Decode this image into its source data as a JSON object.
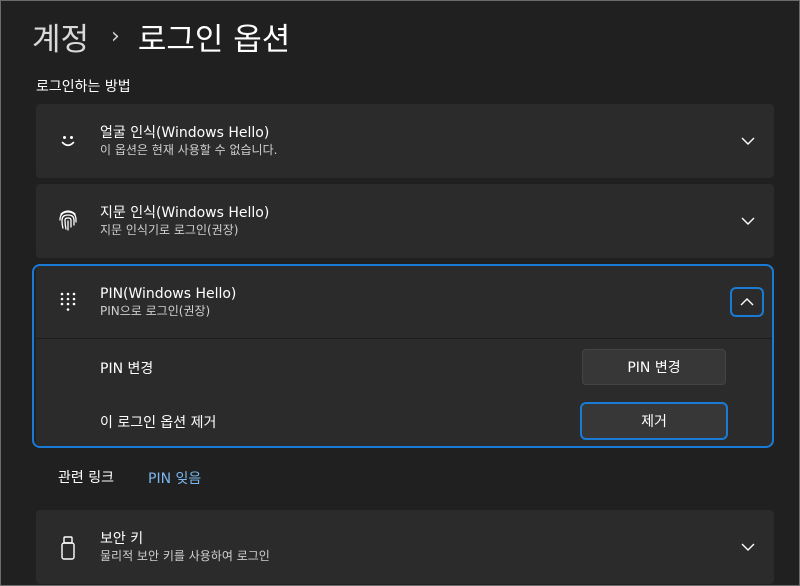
{
  "breadcrumb": {
    "parent": "계정",
    "separator": "›",
    "current": "로그인 옵션"
  },
  "section_title": "로그인하는 방법",
  "options": {
    "face": {
      "title": "얼굴 인식(Windows Hello)",
      "subtitle": "이 옵션은 현재 사용할 수 없습니다.",
      "icon": "smiley-face-icon"
    },
    "fingerprint": {
      "title": "지문 인식(Windows Hello)",
      "subtitle": "지문 인식기로 로그인(권장)",
      "icon": "fingerprint-icon"
    },
    "pin": {
      "title": "PIN(Windows Hello)",
      "subtitle": "PIN으로 로그인(권장)",
      "icon": "keypad-icon",
      "expanded": true,
      "change_label": "PIN 변경",
      "change_button": "PIN 변경",
      "remove_label": "이 로그인 옵션 제거",
      "remove_button": "제거"
    },
    "security_key": {
      "title": "보안 키",
      "subtitle": "물리적 보안 키를 사용하여 로그인",
      "icon": "usb-key-icon"
    }
  },
  "related": {
    "label": "관련 링크",
    "link": "PIN 잊음"
  },
  "colors": {
    "background": "#202020",
    "card": "#2b2b2b",
    "accent": "#1a7bd6",
    "link": "#7ab7f0"
  }
}
